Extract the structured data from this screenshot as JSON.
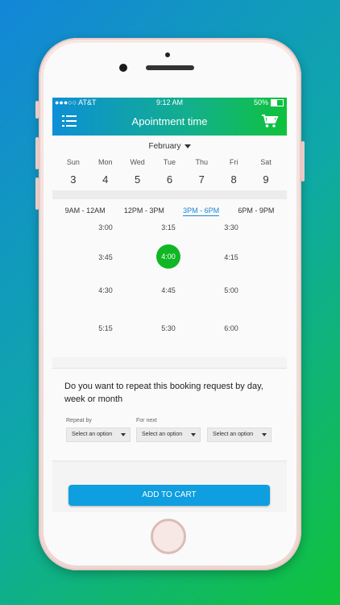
{
  "status_bar": {
    "carrier": "●●●○○ AT&T",
    "time": "9:12 AM",
    "battery": "50%"
  },
  "appbar": {
    "title": "Apointment time"
  },
  "calendar": {
    "month": "February",
    "days": [
      {
        "name": "Sun",
        "date": "3"
      },
      {
        "name": "Mon",
        "date": "4"
      },
      {
        "name": "Wed",
        "date": "5"
      },
      {
        "name": "Tue",
        "date": "6"
      },
      {
        "name": "Thu",
        "date": "7"
      },
      {
        "name": "Fri",
        "date": "8"
      },
      {
        "name": "Sat",
        "date": "9"
      }
    ]
  },
  "time_ranges": [
    {
      "label": "9AM - 12AM",
      "active": false
    },
    {
      "label": "12PM - 3PM",
      "active": false
    },
    {
      "label": "3PM - 6PM",
      "active": true
    },
    {
      "label": "6PM - 9PM",
      "active": false
    }
  ],
  "time_slots": [
    [
      "3:00",
      "3:15",
      "3:30"
    ],
    [
      "3:45",
      "4:00",
      "4:15"
    ],
    [
      "4:30",
      "4:45",
      "5:00"
    ],
    [
      "5:15",
      "5:30",
      "6:00"
    ]
  ],
  "selected_slot": "4:00",
  "repeat": {
    "question": "Do you want to repeat this booking request by day, week or month",
    "repeat_by_label": "Repeat by",
    "for_next_label": "For next",
    "select_placeholder": "Select an option"
  },
  "add_to_cart_label": "ADD TO CART",
  "colors": {
    "accent_blue": "#0f9ee0",
    "selected_green": "#11b624",
    "header_gradient_start": "#0d8fd6",
    "header_gradient_end": "#0fc23c"
  }
}
